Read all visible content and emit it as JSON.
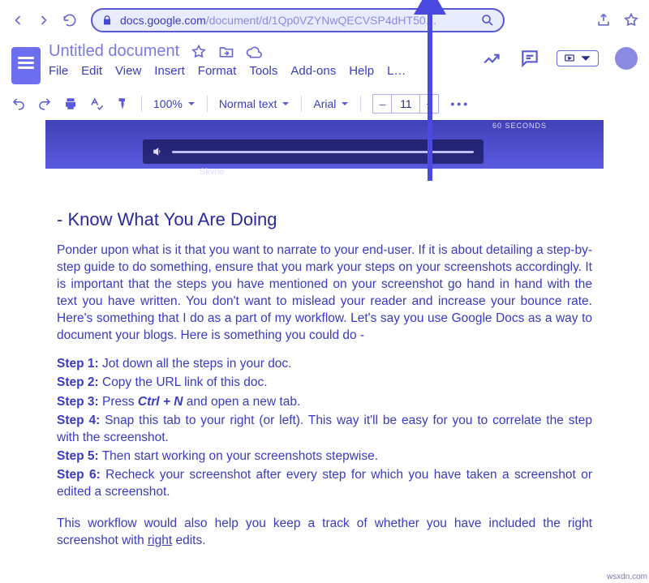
{
  "browser": {
    "url_host": "docs.google.com",
    "url_path": "/document/d/1Qp0VZYNwQECVSP4dHT50…"
  },
  "docs": {
    "title": "Untitled document",
    "menus": [
      "File",
      "Edit",
      "View",
      "Insert",
      "Format",
      "Tools",
      "Add-ons",
      "Help",
      "L…"
    ]
  },
  "toolbar": {
    "zoom": "100%",
    "style": "Normal text",
    "font": "Arial",
    "font_size": "11",
    "minus": "–",
    "plus": "+",
    "more": "•••"
  },
  "embed": {
    "seconds_label": "60 SECONDS",
    "skype": "Skvne"
  },
  "article": {
    "heading_prefix": "- ",
    "heading": "Know What You Are Doing",
    "intro": "Ponder upon what is it that you want to narrate to your end-user. If it is about detailing a step-by-step guide to do something, ensure that you mark your steps on your screenshots accordingly. It is important that the steps you have mentioned on your screenshot go hand in hand with the text you have written. You don't want to mislead your reader and increase your bounce rate. Here's something that I do as a part of my workflow. Let's say you use Google Docs as a way to document your blogs. Here is something you could do -",
    "steps": [
      {
        "label": "Step 1:",
        "text": " Jot down all the steps in your doc."
      },
      {
        "label": "Step 2:",
        "text": " Copy the URL link of this doc."
      },
      {
        "label": "Step 3:",
        "pre": " Press ",
        "kbd": "Ctrl + N",
        "post": " and open a new tab."
      },
      {
        "label": "Step 4:",
        "text": " Snap this tab to your right (or left). This way it'll be easy for you to correlate the step with the screenshot."
      },
      {
        "label": "Step 5:",
        "text": " Then start working on your screenshots stepwise."
      },
      {
        "label": "Step 6:",
        "text": " Recheck your screenshot after every step for which you have taken a screenshot or edited a screenshot."
      }
    ],
    "outro_pre": "This workflow would also help you keep a track of whether you have included the right screenshot with ",
    "outro_ul": "right",
    "outro_post": " edits."
  },
  "watermark": "wsxdn.com"
}
